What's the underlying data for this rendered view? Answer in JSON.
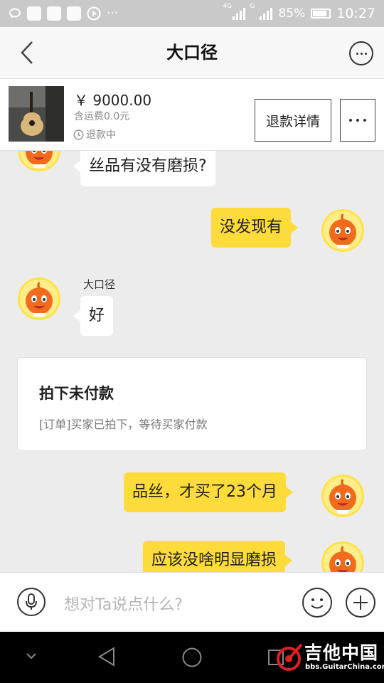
{
  "status_bar": {
    "network_1": "4G",
    "network_2": "G",
    "battery": "85%",
    "time": "10:27",
    "icons": [
      "chat-bubble-icon",
      "app-icon",
      "app-icon",
      "app-icon",
      "play-icon",
      "more-icon"
    ]
  },
  "header": {
    "title": "大口径",
    "back_icon": "chevron-left-icon",
    "more_icon": "more-horizontal-icon"
  },
  "product": {
    "price": "￥ 9000.00",
    "shipping": "含运费0.0元",
    "status": "退款中",
    "refund_button": "退款详情"
  },
  "chat": {
    "messages": [
      {
        "side": "left",
        "text": "丝品有没有磨损?"
      },
      {
        "side": "right",
        "text": "没发现有"
      },
      {
        "side": "left",
        "sender": "大口径",
        "text": "好"
      },
      {
        "side": "right",
        "text": "品丝，才买了23个月"
      },
      {
        "side": "right",
        "text": "应该没啥明显磨损"
      }
    ],
    "order_card": {
      "title": "拍下未付款",
      "desc": "[订单]买家已拍下，等待买家付款"
    }
  },
  "input_bar": {
    "placeholder": "想对Ta说点什么?"
  },
  "watermark": {
    "title": "吉他中国",
    "url": "bbs.GuitarChina.com"
  },
  "colors": {
    "bubble_mine": "#fddb3a",
    "bubble_other": "#ffffff",
    "avatar": "#f26b1d",
    "background": "#ececec"
  },
  "battery_level": 0.85
}
